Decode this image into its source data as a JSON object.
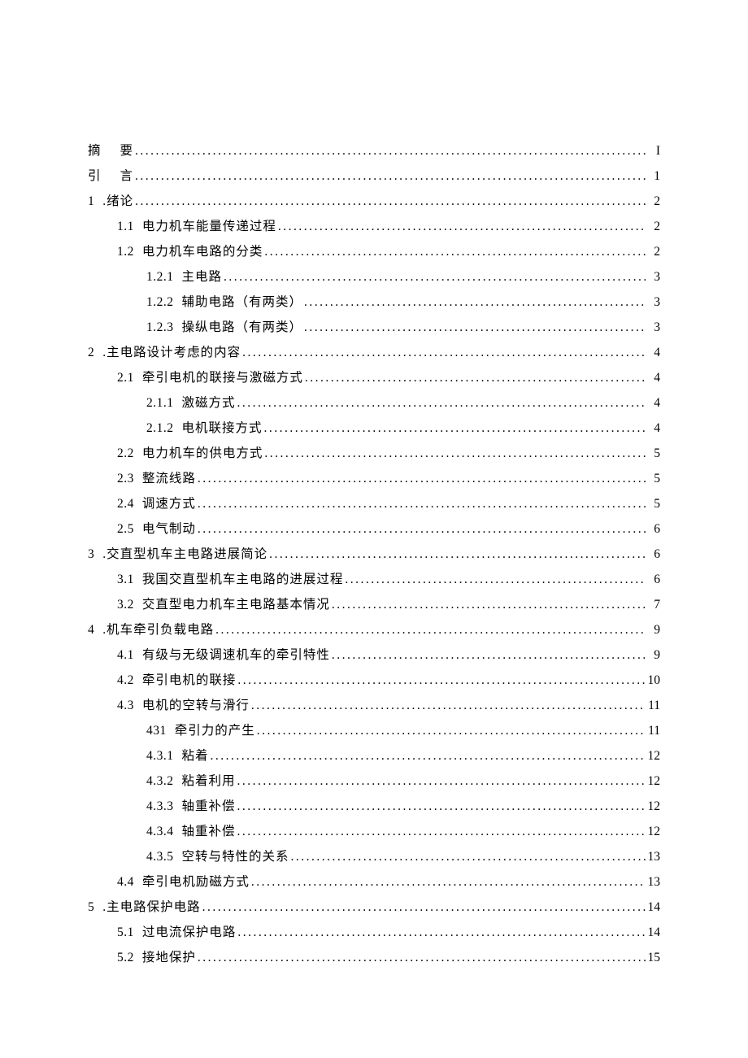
{
  "toc": [
    {
      "level": 0,
      "num": "摘",
      "title": "要",
      "page": "I",
      "spaced": true
    },
    {
      "level": 0,
      "num": "引",
      "title": "言",
      "page": "1",
      "spaced": true
    },
    {
      "level": 0,
      "num": "1",
      "title": ".绪论",
      "page": "2"
    },
    {
      "level": 1,
      "num": "1.1",
      "title": "电力机车能量传递过程",
      "page": "2"
    },
    {
      "level": 1,
      "num": "1.2",
      "title": "电力机车电路的分类",
      "page": "2"
    },
    {
      "level": 2,
      "num": "1.2.1",
      "title": "主电路",
      "page": "3"
    },
    {
      "level": 2,
      "num": "1.2.2",
      "title": "辅助电路（有两类）",
      "page": "3"
    },
    {
      "level": 2,
      "num": "1.2.3",
      "title": "操纵电路（有两类）",
      "page": "3"
    },
    {
      "level": 0,
      "num": "2",
      "title": ".主电路设计考虑的内容",
      "page": "4"
    },
    {
      "level": 1,
      "num": "2.1",
      "title": "牵引电机的联接与激磁方式",
      "page": "4"
    },
    {
      "level": 2,
      "num": "2.1.1",
      "title": "激磁方式",
      "page": "4"
    },
    {
      "level": 2,
      "num": "2.1.2",
      "title": "电机联接方式",
      "page": "4"
    },
    {
      "level": 1,
      "num": "2.2",
      "title": "电力机车的供电方式",
      "page": "5"
    },
    {
      "level": 1,
      "num": "2.3",
      "title": "整流线路",
      "page": "5"
    },
    {
      "level": 1,
      "num": "2.4",
      "title": "调速方式",
      "page": "5"
    },
    {
      "level": 1,
      "num": "2.5",
      "title": "电气制动",
      "page": "6"
    },
    {
      "level": 0,
      "num": "3",
      "title": ".交直型机车主电路进展简论",
      "page": "6"
    },
    {
      "level": 1,
      "num": "3.1",
      "title": "我国交直型机车主电路的进展过程",
      "page": "6"
    },
    {
      "level": 1,
      "num": "3.2",
      "title": "交直型电力机车主电路基本情况",
      "page": "7"
    },
    {
      "level": 0,
      "num": "4",
      "title": ".机车牵引负载电路",
      "page": "9"
    },
    {
      "level": 1,
      "num": "4.1",
      "title": "有级与无级调速机车的牵引特性",
      "page": "9"
    },
    {
      "level": 1,
      "num": "4.2",
      "title": "牵引电机的联接",
      "page": "10"
    },
    {
      "level": 1,
      "num": "4.3",
      "title": "电机的空转与滑行",
      "page": "11"
    },
    {
      "level": 2,
      "num": "431",
      "title": "牵引力的产生",
      "page": "11",
      "numcj": true
    },
    {
      "level": 2,
      "num": "4.3.1",
      "title": "粘着",
      "page": "12"
    },
    {
      "level": 2,
      "num": "4.3.2",
      "title": "粘着利用",
      "page": "12"
    },
    {
      "level": 2,
      "num": "4.3.3",
      "title": "轴重补偿",
      "page": "12"
    },
    {
      "level": 2,
      "num": "4.3.4",
      "title": "轴重补偿",
      "page": "12"
    },
    {
      "level": 2,
      "num": "4.3.5",
      "title": "空转与特性的关系",
      "page": "13"
    },
    {
      "level": 1,
      "num": "4.4",
      "title": "牵引电机励磁方式",
      "page": "13"
    },
    {
      "level": 0,
      "num": "5",
      "title": ".主电路保护电路",
      "page": "14"
    },
    {
      "level": 1,
      "num": "5.1",
      "title": "过电流保护电路",
      "page": "14"
    },
    {
      "level": 1,
      "num": "5.2",
      "title": "接地保护",
      "page": "15"
    }
  ]
}
